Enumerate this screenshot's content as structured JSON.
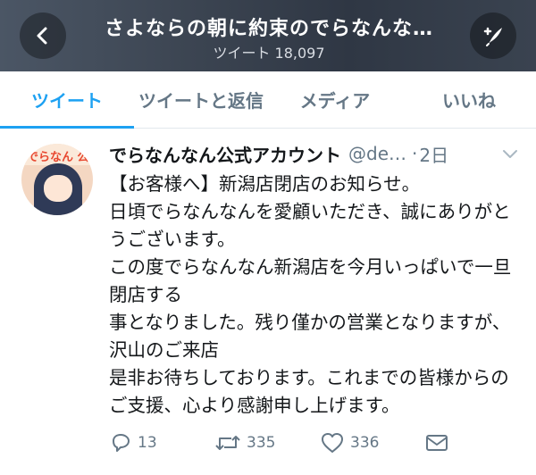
{
  "header": {
    "title": "さよならの朝に約束のでらなんな…",
    "subtitle": "ツイート 18,097",
    "back_icon": "chevron-left-icon",
    "compose_icon": "compose-tweet-icon"
  },
  "tabs": [
    {
      "label": "ツイート",
      "active": true
    },
    {
      "label": "ツイートと返信",
      "active": false
    },
    {
      "label": "メディア",
      "active": false
    },
    {
      "label": "いいね",
      "active": false
    }
  ],
  "tweet": {
    "avatar_text": "でらなん 公式",
    "display_name": "でらなんなん公式アカウント",
    "handle": "@de…",
    "separator": "·",
    "time": "2日",
    "body": "【お客様へ】新潟店閉店のお知らせ。\n日頃でらなんなんを愛顧いただき、誠にありがとうございます。\nこの度でらなんなん新潟店を今月いっぱいで一旦閉店する\n事となりました。残り僅かの営業となりますが、沢山のご来店\n是非お待ちしております。これまでの皆様からのご支援、心より感謝申し上げます。",
    "actions": {
      "reply_count": "13",
      "retweet_count": "335",
      "like_count": "336"
    }
  },
  "colors": {
    "accent": "#1da1f2",
    "secondary_text": "#657786",
    "primary_text": "#14171a"
  }
}
